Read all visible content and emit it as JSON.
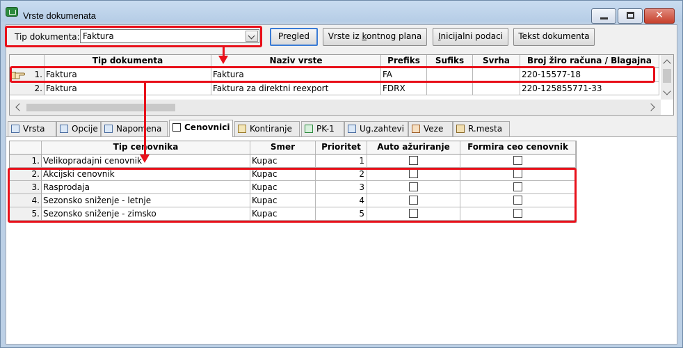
{
  "window": {
    "title": "Vrste dokumenata",
    "min_glyph": "",
    "max_glyph": "",
    "close_glyph": "✕"
  },
  "toolbar": {
    "tip_label": "Tip dokumenta:",
    "tip_value": "Faktura",
    "buttons": {
      "pregled": "Pregled",
      "vrste_pre": "Vrste iz ",
      "vrste_ul": "k",
      "vrste_post": "ontnog plana",
      "inic_ul": "I",
      "inic_post": "nicijalni podaci",
      "tekst": "Tekst dokumenta"
    }
  },
  "upper_grid": {
    "columns": [
      "Tip dokumenta",
      "Naziv vrste",
      "Prefiks",
      "Sufiks",
      "Svrha",
      "Broj žiro računa / Blagajna"
    ],
    "rows": [
      {
        "num": "1.",
        "tip": "Faktura",
        "naziv": "Faktura",
        "prefiks": "FA",
        "sufiks": "",
        "svrha": "",
        "broj": "220-15577-18"
      },
      {
        "num": "2.",
        "tip": "Faktura",
        "naziv": "Faktura za direktni reexport",
        "prefiks": "FDRX",
        "sufiks": "",
        "svrha": "",
        "broj": "220-125855771-33"
      }
    ]
  },
  "tabs": [
    {
      "label": "Vrsta",
      "icon": "document-icon"
    },
    {
      "label": "Opcije",
      "icon": "options-grid-icon"
    },
    {
      "label": "Napomena",
      "icon": "note-icon"
    },
    {
      "label": "Cenovnici",
      "icon": "price-list-icon",
      "active": true
    },
    {
      "label": "Kontiranje",
      "icon": "accounting-icon"
    },
    {
      "label": "PK-1",
      "icon": "pk1-icon"
    },
    {
      "label": "Ug.zahtevi",
      "icon": "requirements-icon"
    },
    {
      "label": "Veze",
      "icon": "links-icon"
    },
    {
      "label": "R.mesta",
      "icon": "workplace-icon"
    }
  ],
  "lower_grid": {
    "columns": [
      "Tip cenovnika",
      "Smer",
      "Prioritet",
      "Auto ažuriranje",
      "Formira ceo cenovnik"
    ],
    "rows": [
      {
        "num": "1.",
        "tip": "Velikopradajni cenovnik",
        "smer": "Kupac",
        "prioritet": "1",
        "auto": false,
        "formira": false
      },
      {
        "num": "2.",
        "tip": "Akcijski cenovnik",
        "smer": "Kupac",
        "prioritet": "2",
        "auto": false,
        "formira": false
      },
      {
        "num": "3.",
        "tip": "Rasprodaja",
        "smer": "Kupac",
        "prioritet": "3",
        "auto": false,
        "formira": false
      },
      {
        "num": "4.",
        "tip": "Sezonsko sniženje - letnje",
        "smer": "Kupac",
        "prioritet": "4",
        "auto": false,
        "formira": false
      },
      {
        "num": "5.",
        "tip": "Sezonsko sniženje - zimsko",
        "smer": "Kupac",
        "prioritet": "5",
        "auto": false,
        "formira": false
      }
    ]
  },
  "colors": {
    "annotation": "#e8101a",
    "titlebar": "#bcd0e6",
    "default_button_border": "#3a7bd5"
  }
}
